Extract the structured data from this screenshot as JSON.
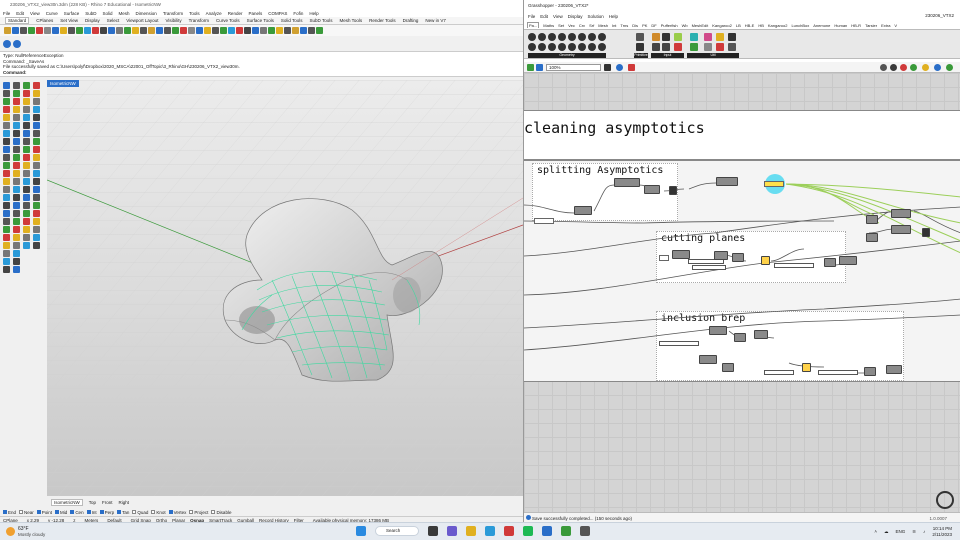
{
  "rhino": {
    "title": "230206_VTX2_view30n.3dm (228 KB) - Rhino 7 Educational - IsometricNW",
    "menu": [
      "File",
      "Edit",
      "View",
      "Curve",
      "Surface",
      "SubD",
      "Solid",
      "Mesh",
      "Dimension",
      "Transform",
      "Tools",
      "Analyze",
      "Render",
      "Panels",
      "COMPAS",
      "Fofin",
      "Help"
    ],
    "tabs": [
      "Standard",
      "CPlanes",
      "Set View",
      "Display",
      "Select",
      "Viewport Layout",
      "Visibility",
      "Transform",
      "Curve Tools",
      "Surface Tools",
      "Solid Tools",
      "SubD Tools",
      "Mesh Tools",
      "Render Tools",
      "Drafting",
      "New in V7"
    ],
    "active_tab": "Standard",
    "command_history": [
      "Type: NullReferenceException",
      "Command: _SaveAs",
      "File successfully saved as C:\\Users\\polyf\\Dropbox\\2020_MSCA\\22001_OffTopic\\3_Rhino\\GH\\230206_VTX2_view30m."
    ],
    "command_prompt": "Command:",
    "viewport_label": "IsometricNW",
    "viewport_tabs": [
      "IsometricNW",
      "Top",
      "Front",
      "Right"
    ],
    "active_viewport_tab": "IsometricNW",
    "osnaps": [
      {
        "label": "End",
        "on": true
      },
      {
        "label": "Near",
        "on": false
      },
      {
        "label": "Point",
        "on": true
      },
      {
        "label": "Mid",
        "on": true
      },
      {
        "label": "Cen",
        "on": true
      },
      {
        "label": "Int",
        "on": true
      },
      {
        "label": "Perp",
        "on": true
      },
      {
        "label": "Tan",
        "on": true
      },
      {
        "label": "Quad",
        "on": false
      },
      {
        "label": "Knot",
        "on": false
      },
      {
        "label": "Vertex",
        "on": true
      },
      {
        "label": "Project",
        "on": false
      },
      {
        "label": "Disable",
        "on": false
      }
    ],
    "status": {
      "cplane": "CPlane",
      "x": "x 2.29",
      "y": "y -12.28",
      "z": "z",
      "units": "Meters",
      "layer": "Default",
      "toggles": [
        {
          "label": "Grid Snap",
          "on": false
        },
        {
          "label": "Ortho",
          "on": false
        },
        {
          "label": "Planar",
          "on": false
        },
        {
          "label": "Osnap",
          "on": true
        },
        {
          "label": "SmartTrack",
          "on": false
        },
        {
          "label": "Gumball",
          "on": false
        },
        {
          "label": "Record History",
          "on": false
        },
        {
          "label": "Filter",
          "on": false
        }
      ],
      "memory": "Available physical memory: 17386 MB"
    }
  },
  "grasshopper": {
    "title": "Grasshopper - 230206_VTX2*",
    "doc_name": "230206_VTX2",
    "menu": [
      "File",
      "Edit",
      "View",
      "Display",
      "Solution",
      "Help"
    ],
    "tabs": [
      "Pa...",
      "Maths",
      "Set",
      "Vec",
      "Crv",
      "Srf",
      "Mesh",
      "Int",
      "Trns",
      "Dis",
      "PK",
      "DF",
      "Pufferfish",
      "Wb",
      "MeshEdit",
      "Kangaroo2",
      "LB",
      "HB-E",
      "HB",
      "Kangaroo2",
      "LunchBox",
      "Anemone",
      "Human",
      "HB-R",
      "Tarsier",
      "Extra",
      "V"
    ],
    "active_tab": "Pa...",
    "ribbon_groups": [
      "Geometry",
      "Primitive",
      "Input",
      "Util"
    ],
    "zoom": "100%",
    "groups": {
      "section_title": "cleaning asymptotics",
      "splitting": "splitting  Asymptotics",
      "cutting": "cutting planes",
      "inclusion": "inclusion brep"
    },
    "status_message": "Save successfully completed... (150 seconds ago)",
    "version": "1.0.0007"
  },
  "taskbar": {
    "temperature": "63°F",
    "weather": "Mostly cloudy",
    "search": "Search",
    "language": "ENG",
    "time": "10:14 PM",
    "date": "2/11/2023"
  },
  "colors": {
    "rhino_blue": "#2a6ec8",
    "asymptotic_green": "#3fd9a0",
    "gh_wire_green": "#9ccf5a",
    "gh_selected": "#ffe04a"
  }
}
